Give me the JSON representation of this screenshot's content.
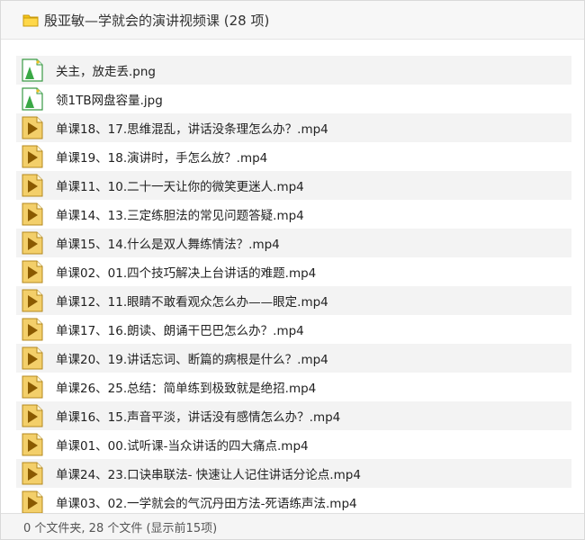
{
  "header": {
    "title": "殷亚敏—学就会的演讲视频课 (28 项)",
    "icon": "folder-icon"
  },
  "files": [
    {
      "name": "关主，放走丢.png",
      "type": "image"
    },
    {
      "name": "领1TB网盘容量.jpg",
      "type": "image"
    },
    {
      "name": "单课18、17.思维混乱，讲话没条理怎么办？.mp4",
      "type": "video"
    },
    {
      "name": "单课19、18.演讲时，手怎么放？.mp4",
      "type": "video"
    },
    {
      "name": "单课11、10.二十一天让你的微笑更迷人.mp4",
      "type": "video"
    },
    {
      "name": "单课14、13.三定练胆法的常见问题答疑.mp4",
      "type": "video"
    },
    {
      "name": "单课15、14.什么是双人舞练情法？.mp4",
      "type": "video"
    },
    {
      "name": "单课02、01.四个技巧解决上台讲话的难题.mp4",
      "type": "video"
    },
    {
      "name": "单课12、11.眼睛不敢看观众怎么办——眼定.mp4",
      "type": "video"
    },
    {
      "name": "单课17、16.朗读、朗诵干巴巴怎么办？.mp4",
      "type": "video"
    },
    {
      "name": "单课20、19.讲话忘词、断篇的病根是什么？.mp4",
      "type": "video"
    },
    {
      "name": "单课26、25.总结：简单练到极致就是绝招.mp4",
      "type": "video"
    },
    {
      "name": "单课16、15.声音平淡，讲话没有感情怎么办？.mp4",
      "type": "video"
    },
    {
      "name": "单课01、00.试听课-当众讲话的四大痛点.mp4",
      "type": "video"
    },
    {
      "name": "单课24、23.口诀串联法- 快速让人记住讲话分论点.mp4",
      "type": "video"
    },
    {
      "name": "单课03、02.一学就会的气沉丹田方法-死语练声法.mp4",
      "type": "video"
    }
  ],
  "footer": {
    "summary": "0 个文件夹, 28 个文件 (显示前15项)"
  },
  "colors": {
    "video_icon": "#d7a93a",
    "image_icon": "#3aa845",
    "row_alt": "#f3f3f3",
    "folder": "#f5c518"
  }
}
